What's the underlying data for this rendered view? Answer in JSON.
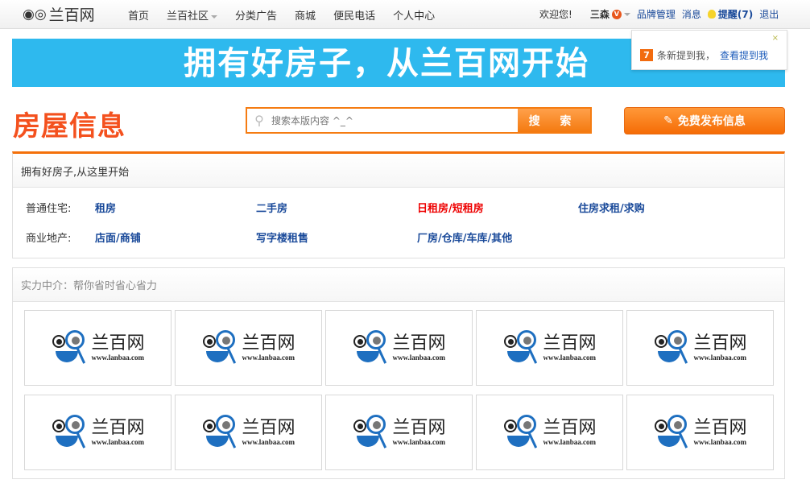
{
  "topbar": {
    "logo_text": "兰百网",
    "nav": [
      "首页",
      "兰百社区",
      "分类广告",
      "商城",
      "便民电话",
      "个人中心"
    ],
    "welcome": "欢迎您!",
    "username": "三森",
    "vip_badge": "V",
    "brand_manage": "品牌管理",
    "messages": "消息",
    "remind": "提醒(7)",
    "logout": "退出"
  },
  "popup": {
    "close": "×",
    "count": "7",
    "text": "条新提到我，",
    "link": "查看提到我"
  },
  "banner": {
    "text": "拥有好房子，从兰百网开始"
  },
  "page_title": "房屋信息",
  "search": {
    "placeholder": "搜索本版内容 ^_^",
    "button": "搜 索"
  },
  "publish_button": "免费发布信息",
  "categories": {
    "header": "拥有好房子,从这里开始",
    "rows": [
      {
        "label": "普通住宅:",
        "links": [
          "租房",
          "二手房",
          "日租房/短租房",
          "住房求租/求购"
        ]
      },
      {
        "label": "商业地产:",
        "links": [
          "店面/商铺",
          "写字楼租售",
          "厂房/仓库/车库/其他"
        ]
      }
    ]
  },
  "agents": {
    "header": "实力中介：帮你省时省心省力",
    "logo_cn": "兰百网",
    "logo_url": "www.lanbaa.com",
    "count": 10
  },
  "colors": {
    "accent": "#f4700a",
    "title": "#f4511e",
    "banner": "#2eb9ee",
    "link": "#1a4a9a",
    "hot": "#ee0000"
  }
}
